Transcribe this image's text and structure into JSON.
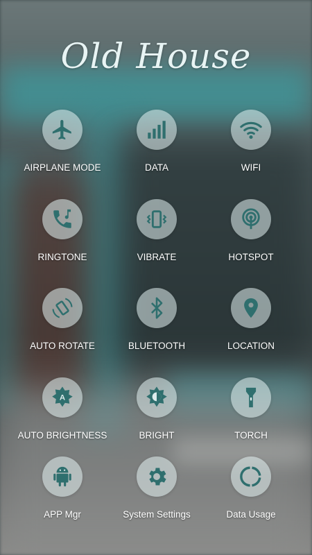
{
  "app": {
    "title": "Old House"
  },
  "colors": {
    "icon_fill": "#2f6f6e",
    "label": "#ffffff",
    "circle_bg": "#dcecec"
  },
  "tiles": [
    {
      "label": "AIRPLANE MODE",
      "icon": "airplane-icon"
    },
    {
      "label": "DATA",
      "icon": "signal-bars-icon"
    },
    {
      "label": "WIFI",
      "icon": "wifi-icon"
    },
    {
      "label": "RINGTONE",
      "icon": "ringtone-icon"
    },
    {
      "label": "VIBRATE",
      "icon": "vibrate-icon"
    },
    {
      "label": "HOTSPOT",
      "icon": "hotspot-icon"
    },
    {
      "label": "AUTO ROTATE",
      "icon": "rotate-icon"
    },
    {
      "label": "BLUETOOTH",
      "icon": "bluetooth-icon"
    },
    {
      "label": "LOCATION",
      "icon": "location-pin-icon"
    },
    {
      "label": "AUTO BRIGHTNESS",
      "icon": "auto-brightness-icon"
    },
    {
      "label": "BRIGHT",
      "icon": "brightness-icon"
    },
    {
      "label": "TORCH",
      "icon": "torch-icon"
    },
    {
      "label": "APP Mgr",
      "icon": "android-icon"
    },
    {
      "label": "System Settings",
      "icon": "gear-icon"
    },
    {
      "label": "Data Usage",
      "icon": "data-usage-icon"
    }
  ]
}
